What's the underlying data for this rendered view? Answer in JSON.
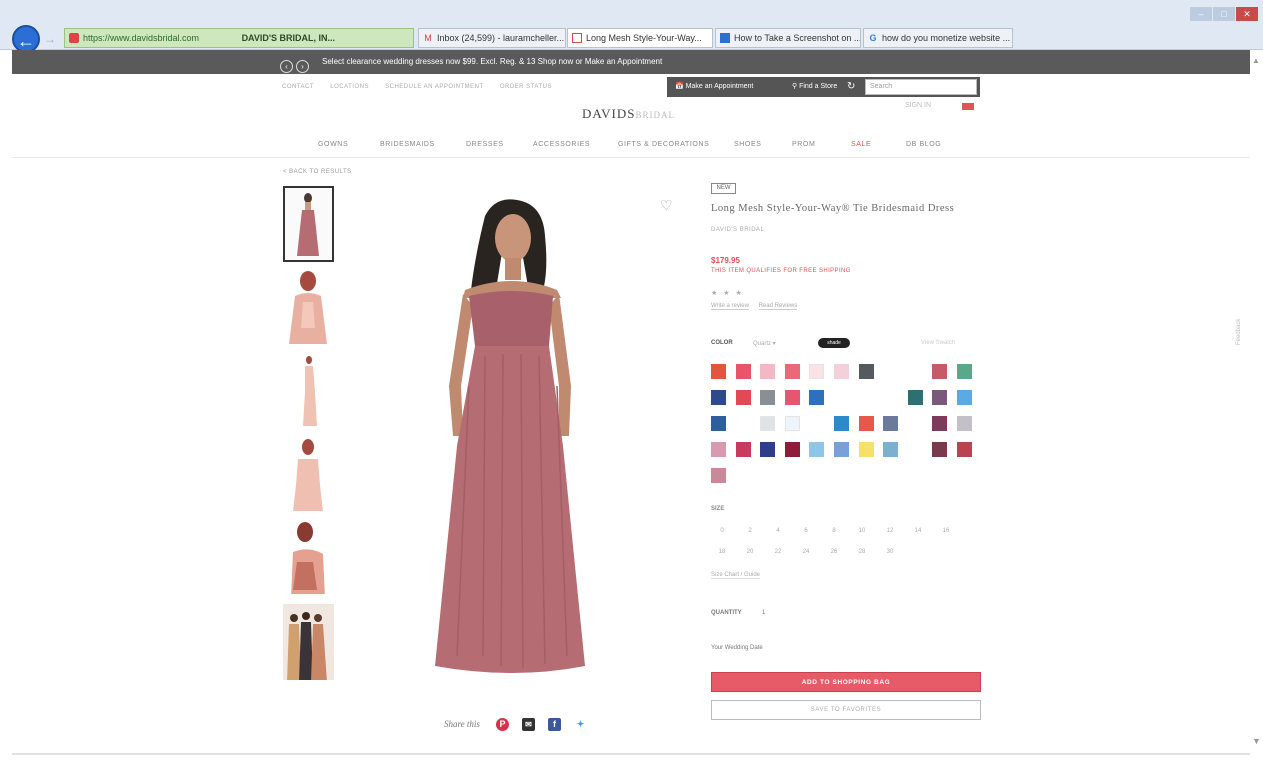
{
  "browser": {
    "address_url": "https://www.davidsbridal.com",
    "site_identity": "DAVID'S BRIDAL, IN...",
    "tabs": [
      {
        "label": "Inbox (24,599) - lauramcheller...",
        "icon": "gmail-icon"
      },
      {
        "label": "Long Mesh Style-Your-Way...",
        "icon": "davids-bridal-tab-icon"
      },
      {
        "label": "How to Take a Screenshot on ...",
        "icon": "page-icon"
      },
      {
        "label": "how do you monetize website ...",
        "icon": "google-icon"
      }
    ]
  },
  "promo": {
    "message": "Select clearance wedding dresses now $99. Excl. Reg. & 13 Shop now or Make an Appointment"
  },
  "header": {
    "util_links": [
      "CONTACT",
      "LOCATIONS",
      "SCHEDULE AN APPOINTMENT",
      "ORDER STATUS"
    ],
    "appointment": "Make an Appointment",
    "find_store": "Find a Store",
    "search_placeholder": "Search",
    "logo_main": "DAVIDS",
    "logo_sub": "BRIDAL",
    "account": "SIGN IN"
  },
  "nav": {
    "items": [
      "GOWNS",
      "BRIDESMAIDS",
      "DRESSES",
      "ACCESSORIES",
      "GIFTS & DECORATIONS",
      "SHOES",
      "PROM",
      "SALE",
      "DB BLOG"
    ]
  },
  "back_link": "< BACK TO RESULTS",
  "share": {
    "label": "Share this"
  },
  "product": {
    "badge": "NEW",
    "title": "Long Mesh Style-Your-Way® Tie Bridesmaid Dress",
    "brand": "DAVID'S BRIDAL",
    "price": "$179.95",
    "shipping_note": "THIS ITEM QUALIFIES FOR FREE SHIPPING",
    "stars": "★ ★ ★",
    "review_links": [
      "Write a review",
      "Read Reviews"
    ],
    "color_label": "COLOR",
    "color_selected": "Quartz",
    "color_pill": "shade",
    "color_hint": "View Swatch",
    "swatches": [
      [
        "#e2553e",
        "#e8546a",
        "#f2b8c4",
        "#ea6878",
        "#fbe2e4",
        "#f6d0d8",
        "#555a60",
        "",
        "",
        "#c65a68",
        "#5aa88a"
      ],
      [
        "#2e4a8c",
        "#e04a55",
        "#8a8f96",
        "#e55670",
        "#2e6fbe",
        "",
        "",
        "",
        "#2f6f72",
        "#7a5a7a",
        "#5aaae6"
      ],
      [
        "#2e5ea0",
        "",
        "#e0e2e8",
        "#eef4fa",
        "",
        "#2d8ac8",
        "#e85848",
        "#6a7a9a",
        "",
        "#7e3a5a",
        "#c4c0c8"
      ],
      [
        "#d89ab0",
        "#c83a5e",
        "#2e3e8a",
        "#8c1e3c",
        "#8ec6ea",
        "#7aa0d8",
        "#f6e06a",
        "#7ab0d0",
        "",
        "#7a3a4e",
        "#b84450"
      ],
      [
        "#c88a98",
        "",
        "",
        "",
        "",
        "",
        "",
        "",
        "",
        "",
        ""
      ]
    ],
    "size_label": "SIZE",
    "sizes_row1": [
      "0",
      "2",
      "4",
      "6",
      "8",
      "10",
      "12",
      "14",
      "16"
    ],
    "sizes_row2": [
      "18",
      "20",
      "22",
      "24",
      "26",
      "28",
      "30"
    ],
    "size_chart": "Size Chart / Guide",
    "quantity_label": "QUANTITY",
    "quantity_value": "1",
    "wedding_label": "Your Wedding Date",
    "add_to_bag": "ADD TO SHOPPING BAG",
    "add_to_favorites": "SAVE TO FAVORITES"
  },
  "feedback": "Feedback",
  "colors": {
    "dress": "#b56d73",
    "accent": "#e75a67",
    "promo_bg": "#5a5a5a"
  }
}
